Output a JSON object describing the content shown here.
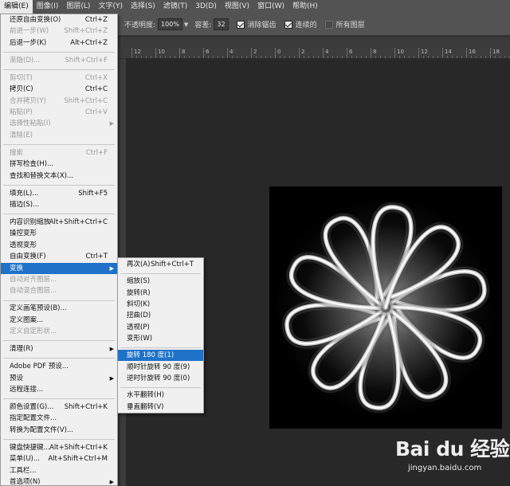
{
  "menubar": {
    "items": [
      {
        "label": "编辑(E)",
        "active": true
      },
      {
        "label": "图像(I)"
      },
      {
        "label": "图层(L)"
      },
      {
        "label": "文字(Y)"
      },
      {
        "label": "选择(S)"
      },
      {
        "label": "滤镜(T)"
      },
      {
        "label": "3D(D)"
      },
      {
        "label": "视图(V)"
      },
      {
        "label": "窗口(W)"
      },
      {
        "label": "帮助(H)"
      }
    ]
  },
  "options_bar": {
    "opacity_label": "不透明度:",
    "opacity_value": "100%",
    "tolerance_label": "容差:",
    "tolerance_value": "32",
    "antialias_label": "消除锯齿",
    "contiguous_label": "连续的",
    "all_layers_label": "所有图层"
  },
  "ruler": {
    "labels": [
      "12",
      "10",
      "8",
      "6",
      "4",
      "2",
      "0",
      "2",
      "4",
      "6",
      "8",
      "10",
      "12",
      "14",
      "16",
      "18"
    ]
  },
  "edit_menu": {
    "items": [
      {
        "label": "还原自由变换(O)",
        "shortcut": "Ctrl+Z"
      },
      {
        "label": "前进一步(W)",
        "shortcut": "Shift+Ctrl+Z",
        "disabled": true
      },
      {
        "label": "后退一步(K)",
        "shortcut": "Alt+Ctrl+Z"
      },
      {
        "sep": true
      },
      {
        "label": "渐隐(D)...",
        "shortcut": "Shift+Ctrl+F",
        "disabled": true
      },
      {
        "sep": true
      },
      {
        "label": "剪切(T)",
        "shortcut": "Ctrl+X",
        "disabled": true
      },
      {
        "label": "拷贝(C)",
        "shortcut": "Ctrl+C"
      },
      {
        "label": "合并拷贝(Y)",
        "shortcut": "Shift+Ctrl+C",
        "disabled": true
      },
      {
        "label": "粘贴(P)",
        "shortcut": "Ctrl+V",
        "disabled": true
      },
      {
        "label": "选择性粘贴(I)",
        "submenu": true,
        "disabled": true
      },
      {
        "label": "清除(E)",
        "disabled": true
      },
      {
        "sep": true
      },
      {
        "label": "搜索",
        "shortcut": "Ctrl+F",
        "disabled": true
      },
      {
        "label": "拼写检查(H)..."
      },
      {
        "label": "查找和替换文本(X)..."
      },
      {
        "sep": true
      },
      {
        "label": "填充(L)...",
        "shortcut": "Shift+F5"
      },
      {
        "label": "描边(S)..."
      },
      {
        "sep": true
      },
      {
        "label": "内容识别缩放",
        "shortcut": "Alt+Shift+Ctrl+C"
      },
      {
        "label": "操控变形"
      },
      {
        "label": "透视变形"
      },
      {
        "label": "自由变换(F)",
        "shortcut": "Ctrl+T"
      },
      {
        "label": "变换",
        "submenu": true,
        "highlighted": true
      },
      {
        "label": "自动对齐图层...",
        "disabled": true
      },
      {
        "label": "自动混合图层...",
        "disabled": true
      },
      {
        "sep": true
      },
      {
        "label": "定义画笔预设(B)..."
      },
      {
        "label": "定义图案..."
      },
      {
        "label": "定义自定形状...",
        "disabled": true
      },
      {
        "sep": true
      },
      {
        "label": "清理(R)",
        "submenu": true
      },
      {
        "sep": true
      },
      {
        "label": "Adobe PDF 预设..."
      },
      {
        "label": "预设",
        "submenu": true
      },
      {
        "label": "远程连接..."
      },
      {
        "sep": true
      },
      {
        "label": "颜色设置(G)...",
        "shortcut": "Shift+Ctrl+K"
      },
      {
        "label": "指定配置文件..."
      },
      {
        "label": "转换为配置文件(V)..."
      },
      {
        "sep": true
      },
      {
        "label": "键盘快捷键...",
        "shortcut": "Alt+Shift+Ctrl+K"
      },
      {
        "label": "菜单(U)...",
        "shortcut": "Alt+Shift+Ctrl+M"
      },
      {
        "label": "工具栏..."
      },
      {
        "label": "首选项(N)",
        "submenu": true
      }
    ]
  },
  "transform_menu": {
    "items": [
      {
        "label": "再次(A)",
        "shortcut": "Shift+Ctrl+T"
      },
      {
        "sep": true
      },
      {
        "label": "缩放(S)"
      },
      {
        "label": "旋转(R)"
      },
      {
        "label": "斜切(K)"
      },
      {
        "label": "扭曲(D)"
      },
      {
        "label": "透视(P)"
      },
      {
        "label": "变形(W)"
      },
      {
        "sep": true
      },
      {
        "label": "旋转 180 度(1)",
        "highlighted": true
      },
      {
        "label": "顺时针旋转 90 度(9)"
      },
      {
        "label": "逆时针旋转 90 度(0)"
      },
      {
        "sep": true
      },
      {
        "label": "水平翻转(H)"
      },
      {
        "label": "垂直翻转(V)"
      }
    ]
  },
  "watermark": {
    "logo": "Bai du 经验",
    "url": "jingyan.baidu.com"
  }
}
